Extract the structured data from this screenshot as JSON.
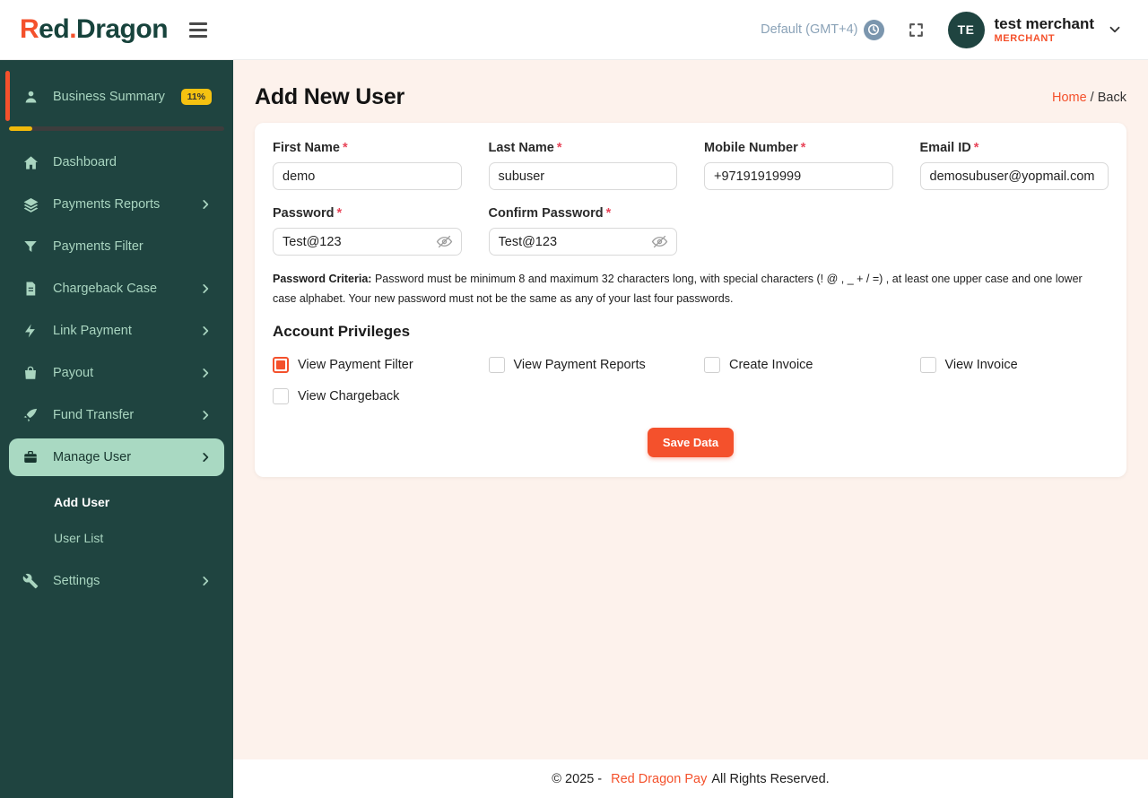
{
  "colors": {
    "accent": "#f4512c",
    "sidebar_bg": "#1f4440",
    "sidebar_text": "#a9d5c0",
    "active_item_bg": "#a9d9c2",
    "badge_yellow": "#f5c211",
    "progress_yellow": "#f0b90b",
    "clock_badge_bg": "#7b96ae",
    "main_bg": "#fdf2ec"
  },
  "header": {
    "logo": {
      "part1": "R",
      "part2": "ed",
      "dot": ".",
      "part3": "Dragon"
    },
    "timezone_label": "Default (GMT+4)",
    "icons": [
      "hamburger-icon",
      "clock-icon",
      "fullscreen-icon",
      "chevron-down-icon"
    ],
    "user": {
      "initials": "TE",
      "name": "test merchant",
      "role": "MERCHANT"
    }
  },
  "sidebar": {
    "items": [
      {
        "label": "Business Summary",
        "icon": "person-icon",
        "badge": "11%",
        "progress_percent": 11,
        "active": false,
        "has_chevron": false
      },
      {
        "label": "Dashboard",
        "icon": "home-icon",
        "active": false,
        "has_chevron": false
      },
      {
        "label": "Payments Reports",
        "icon": "layers-icon",
        "active": false,
        "has_chevron": true
      },
      {
        "label": "Payments Filter",
        "icon": "funnel-icon",
        "active": false,
        "has_chevron": false
      },
      {
        "label": "Chargeback Case",
        "icon": "document-icon",
        "active": false,
        "has_chevron": true
      },
      {
        "label": "Link Payment",
        "icon": "bolt-icon",
        "active": false,
        "has_chevron": true
      },
      {
        "label": "Payout",
        "icon": "bag-icon",
        "active": false,
        "has_chevron": true
      },
      {
        "label": "Fund Transfer",
        "icon": "rocket-icon",
        "active": false,
        "has_chevron": true
      },
      {
        "label": "Manage User",
        "icon": "briefcase-icon",
        "active": true,
        "has_chevron": true
      },
      {
        "label": "Settings",
        "icon": "wrench-icon",
        "active": false,
        "has_chevron": true
      }
    ],
    "submenu": {
      "parent": "Manage User",
      "items": [
        {
          "label": "Add User",
          "active": true
        },
        {
          "label": "User List",
          "active": false
        }
      ]
    }
  },
  "page": {
    "title": "Add New User",
    "breadcrumb": {
      "home": "Home",
      "separator": " / ",
      "current": "Back"
    }
  },
  "form": {
    "fields": [
      {
        "label": "First Name",
        "required": "*",
        "value": "demo"
      },
      {
        "label": "Last Name",
        "required": "*",
        "value": "subuser"
      },
      {
        "label": "Mobile Number",
        "required": "*",
        "value": "+97191919999"
      },
      {
        "label": "Email ID",
        "required": "*",
        "value": "demosubuser@yopmail.com"
      },
      {
        "label": "Password",
        "required": "*",
        "value": "Test@123",
        "icon": "eye-off-icon"
      },
      {
        "label": "Confirm Password",
        "required": "*",
        "value": "Test@123",
        "icon": "eye-off-icon"
      }
    ],
    "password_criteria": {
      "bold": "Password Criteria:",
      "text": " Password must be minimum 8 and maximum 32 characters long, with special characters (! @ , _ + / =) , at least one upper case and one lower case alphabet. Your new password must not be the same as any of your last four passwords."
    },
    "privileges": {
      "heading": "Account Privileges",
      "options": [
        {
          "label": "View Payment Filter",
          "checked": true
        },
        {
          "label": "View Payment Reports",
          "checked": false
        },
        {
          "label": "Create Invoice",
          "checked": false
        },
        {
          "label": "View Invoice",
          "checked": false
        },
        {
          "label": "View Chargeback",
          "checked": false
        }
      ]
    },
    "save_button_label": "Save Data"
  },
  "footer": {
    "prefix": "© 2025 -",
    "brand": "Red Dragon Pay",
    "suffix": "All Rights Reserved."
  }
}
